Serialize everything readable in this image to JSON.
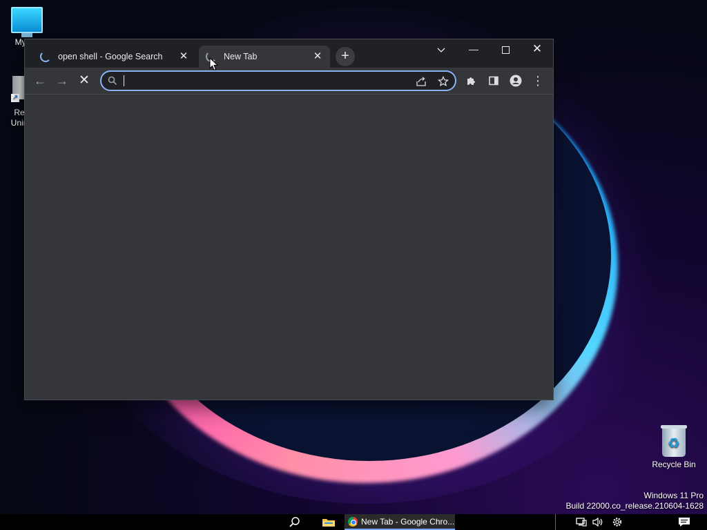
{
  "desktop": {
    "icons": {
      "my_computer": "My Co",
      "uninstaller_line1": "Re",
      "uninstaller_line2": "Unin",
      "recycle_bin": "Recycle Bin"
    },
    "watermark": {
      "edition": "Windows 11 Pro",
      "build": "Build 22000.co_release.210604-1628"
    }
  },
  "browser": {
    "tabs": [
      {
        "title": "open shell - Google Search",
        "close": "✕",
        "loading": true,
        "active": false
      },
      {
        "title": "New Tab",
        "close": "✕",
        "loading": true,
        "active": true
      }
    ],
    "new_tab_label": "+",
    "window_controls": {
      "tab_search": "⌄",
      "minimize": "—",
      "close": "✕"
    },
    "toolbar": {
      "back": "←",
      "forward": "→",
      "stop": "✕",
      "menu": "⋮"
    },
    "omnibox": {
      "value": "",
      "placeholder": ""
    }
  },
  "taskbar": {
    "chrome_task_label": "New Tab - Google Chro..."
  },
  "colors": {
    "frame": "#202124",
    "toolbar": "#35363a",
    "omnibox_focus": "#8ab4f8",
    "text": "#e8eaed"
  }
}
